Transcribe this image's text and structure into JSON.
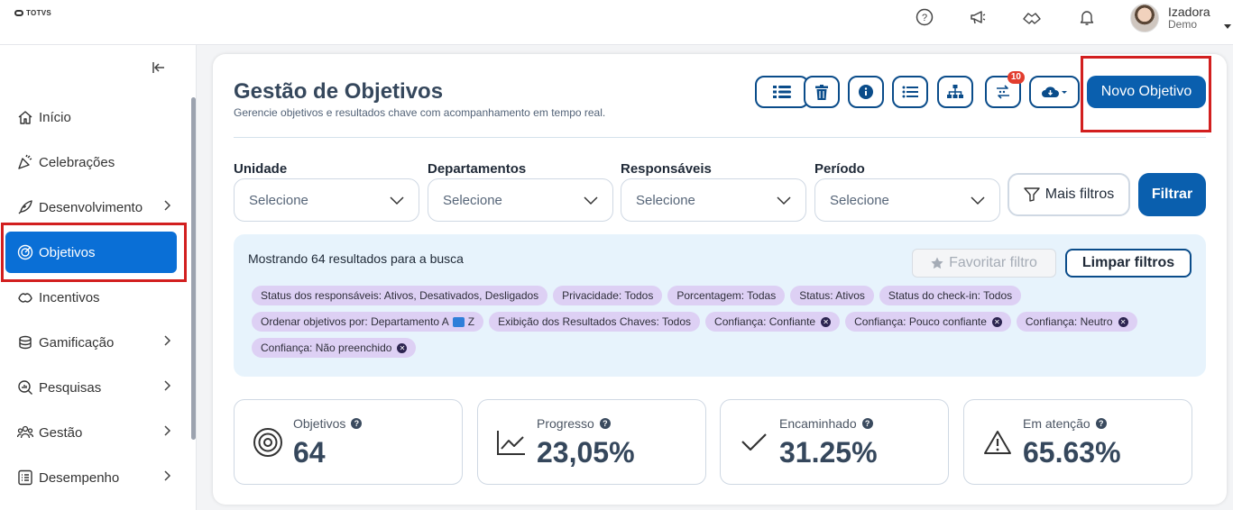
{
  "brand": {
    "logo_text": "TOTVS"
  },
  "header": {
    "icons": [
      "help-icon",
      "megaphone-icon",
      "handshake-icon",
      "bell-icon"
    ],
    "user": {
      "name": "Izadora",
      "role": "Demo"
    }
  },
  "sidebar": {
    "items": [
      {
        "label": "Início",
        "icon": "home-icon",
        "has_submenu": false,
        "active": false
      },
      {
        "label": "Celebrações",
        "icon": "party-icon",
        "has_submenu": false,
        "active": false
      },
      {
        "label": "Desenvolvimento",
        "icon": "rocket-icon",
        "has_submenu": true,
        "active": false
      },
      {
        "label": "Objetivos",
        "icon": "target-icon",
        "has_submenu": false,
        "active": true
      },
      {
        "label": "Incentivos",
        "icon": "incentive-icon",
        "has_submenu": false,
        "active": false
      },
      {
        "label": "Gamificação",
        "icon": "coins-icon",
        "has_submenu": true,
        "active": false
      },
      {
        "label": "Pesquisas",
        "icon": "search-chart-icon",
        "has_submenu": true,
        "active": false
      },
      {
        "label": "Gestão",
        "icon": "people-icon",
        "has_submenu": true,
        "active": false
      },
      {
        "label": "Desempenho",
        "icon": "checklist-icon",
        "has_submenu": true,
        "active": false
      }
    ]
  },
  "page": {
    "title": "Gestão de Objetivos",
    "subtitle": "Gerencie objetivos e resultados chave com acompanhamento em tempo real.",
    "toolbar": {
      "badge_count": "10",
      "new_button": "Novo Objetivo"
    }
  },
  "filters": {
    "fields": [
      {
        "label": "Unidade",
        "placeholder": "Selecione"
      },
      {
        "label": "Departamentos",
        "placeholder": "Selecione"
      },
      {
        "label": "Responsáveis",
        "placeholder": "Selecione"
      },
      {
        "label": "Período",
        "placeholder": "Selecione"
      }
    ],
    "more_filters": "Mais filtros",
    "apply": "Filtrar"
  },
  "results": {
    "summary": "Mostrando 64 resultados para a busca",
    "favorite": "Favoritar filtro",
    "clear": "Limpar filtros",
    "chips": [
      {
        "text": "Status dos responsáveis: Ativos, Desativados, Desligados",
        "removable": false
      },
      {
        "text": "Privacidade: Todos",
        "removable": false
      },
      {
        "text": "Porcentagem: Todas",
        "removable": false
      },
      {
        "text": "Status: Ativos",
        "removable": false
      },
      {
        "text": "Status do check-in: Todos",
        "removable": false
      },
      {
        "text": "Ordenar objetivos por: Departamento A",
        "suffix": "Z",
        "removable": false
      },
      {
        "text": "Exibição dos Resultados Chaves: Todos",
        "removable": false
      },
      {
        "text": "Confiança: Confiante",
        "removable": true
      },
      {
        "text": "Confiança: Pouco confiante",
        "removable": true
      },
      {
        "text": "Confiança: Neutro",
        "removable": true
      },
      {
        "text": "Confiança: Não preenchido",
        "removable": true
      }
    ]
  },
  "stats": [
    {
      "label": "Objetivos",
      "value": "64",
      "icon": "target-icon"
    },
    {
      "label": "Progresso",
      "value": "23,05%",
      "icon": "line-chart-icon"
    },
    {
      "label": "Encaminhado",
      "value": "31.25%",
      "icon": "check-icon"
    },
    {
      "label": "Em atenção",
      "value": "65.63%",
      "icon": "warning-icon"
    }
  ]
}
